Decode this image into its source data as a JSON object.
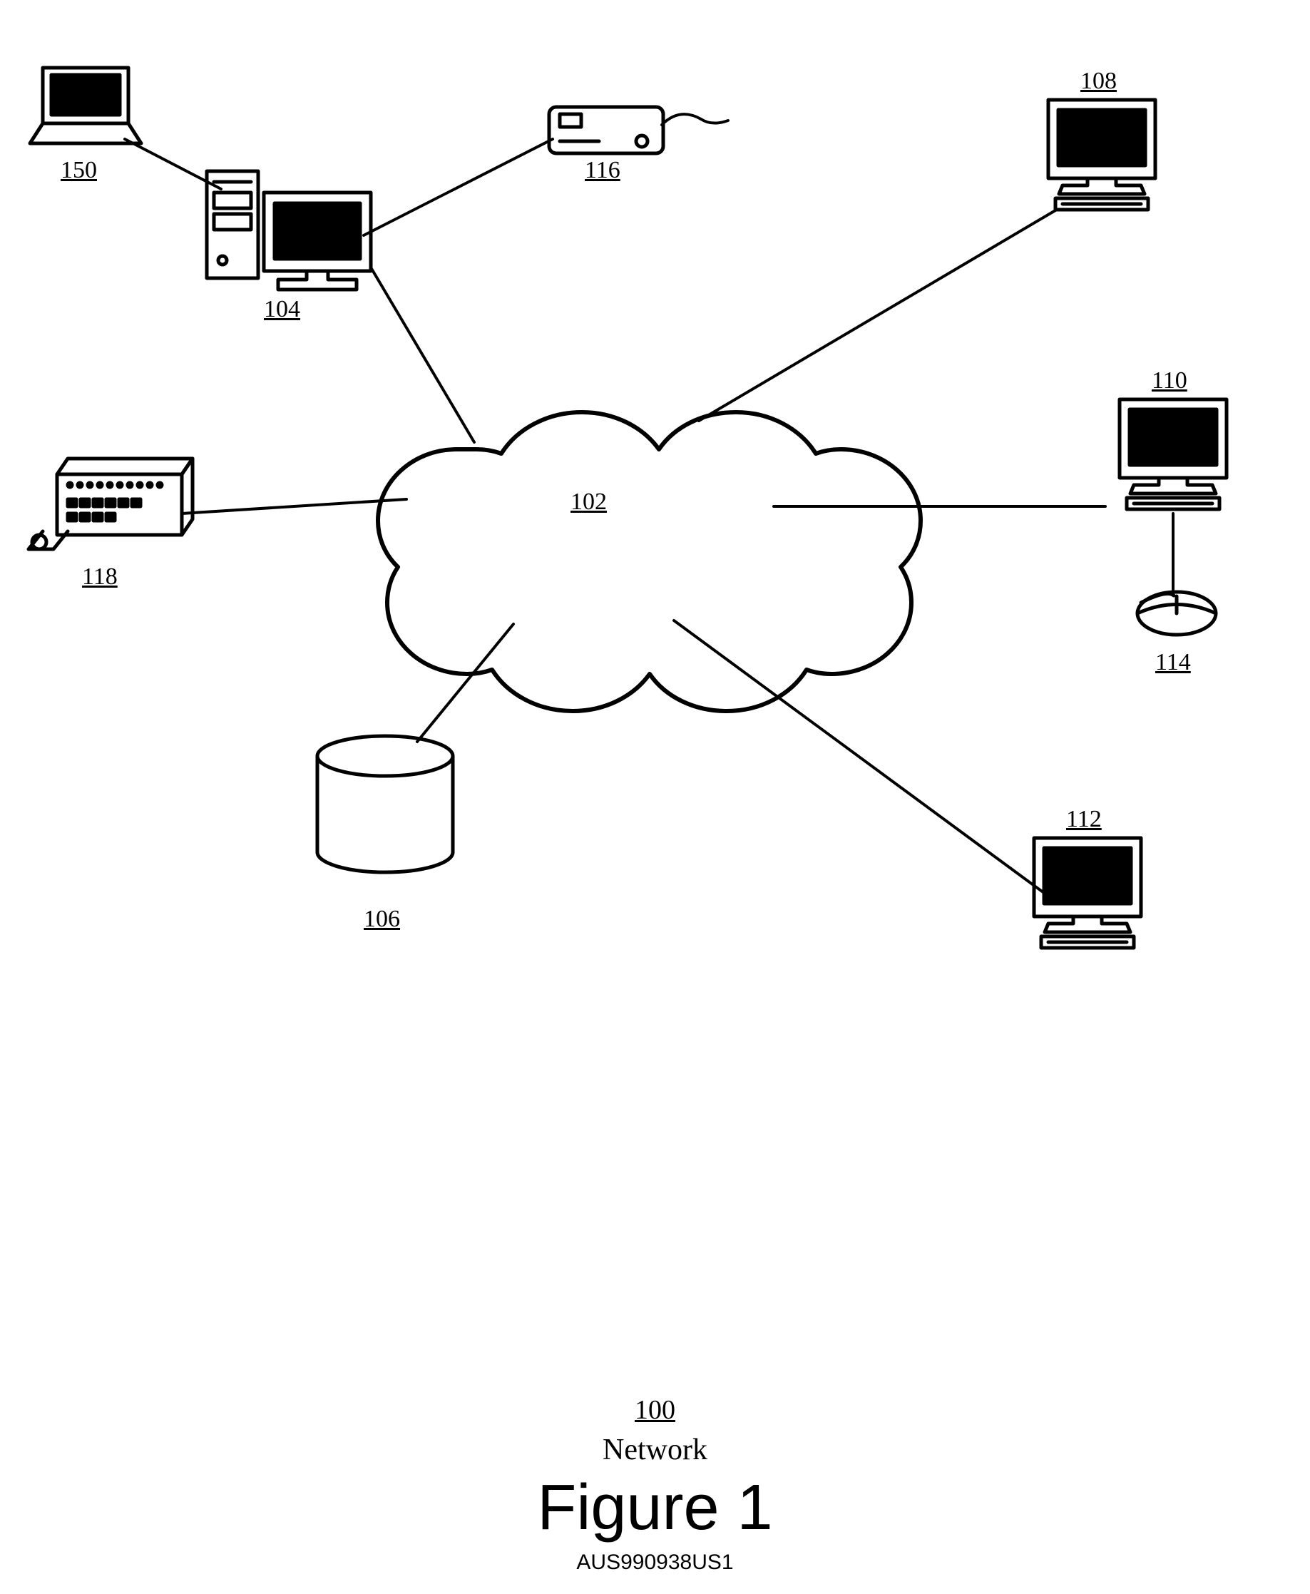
{
  "labels": {
    "cloud": "102",
    "server": "104",
    "database": "106",
    "client_top": "108",
    "client_right": "110",
    "client_bottom": "112",
    "mouse": "114",
    "projector": "116",
    "printer": "118",
    "laptop": "150"
  },
  "caption": {
    "ref": "100",
    "word": "Network",
    "figure": "Figure 1",
    "code": "AUS990938US1"
  }
}
